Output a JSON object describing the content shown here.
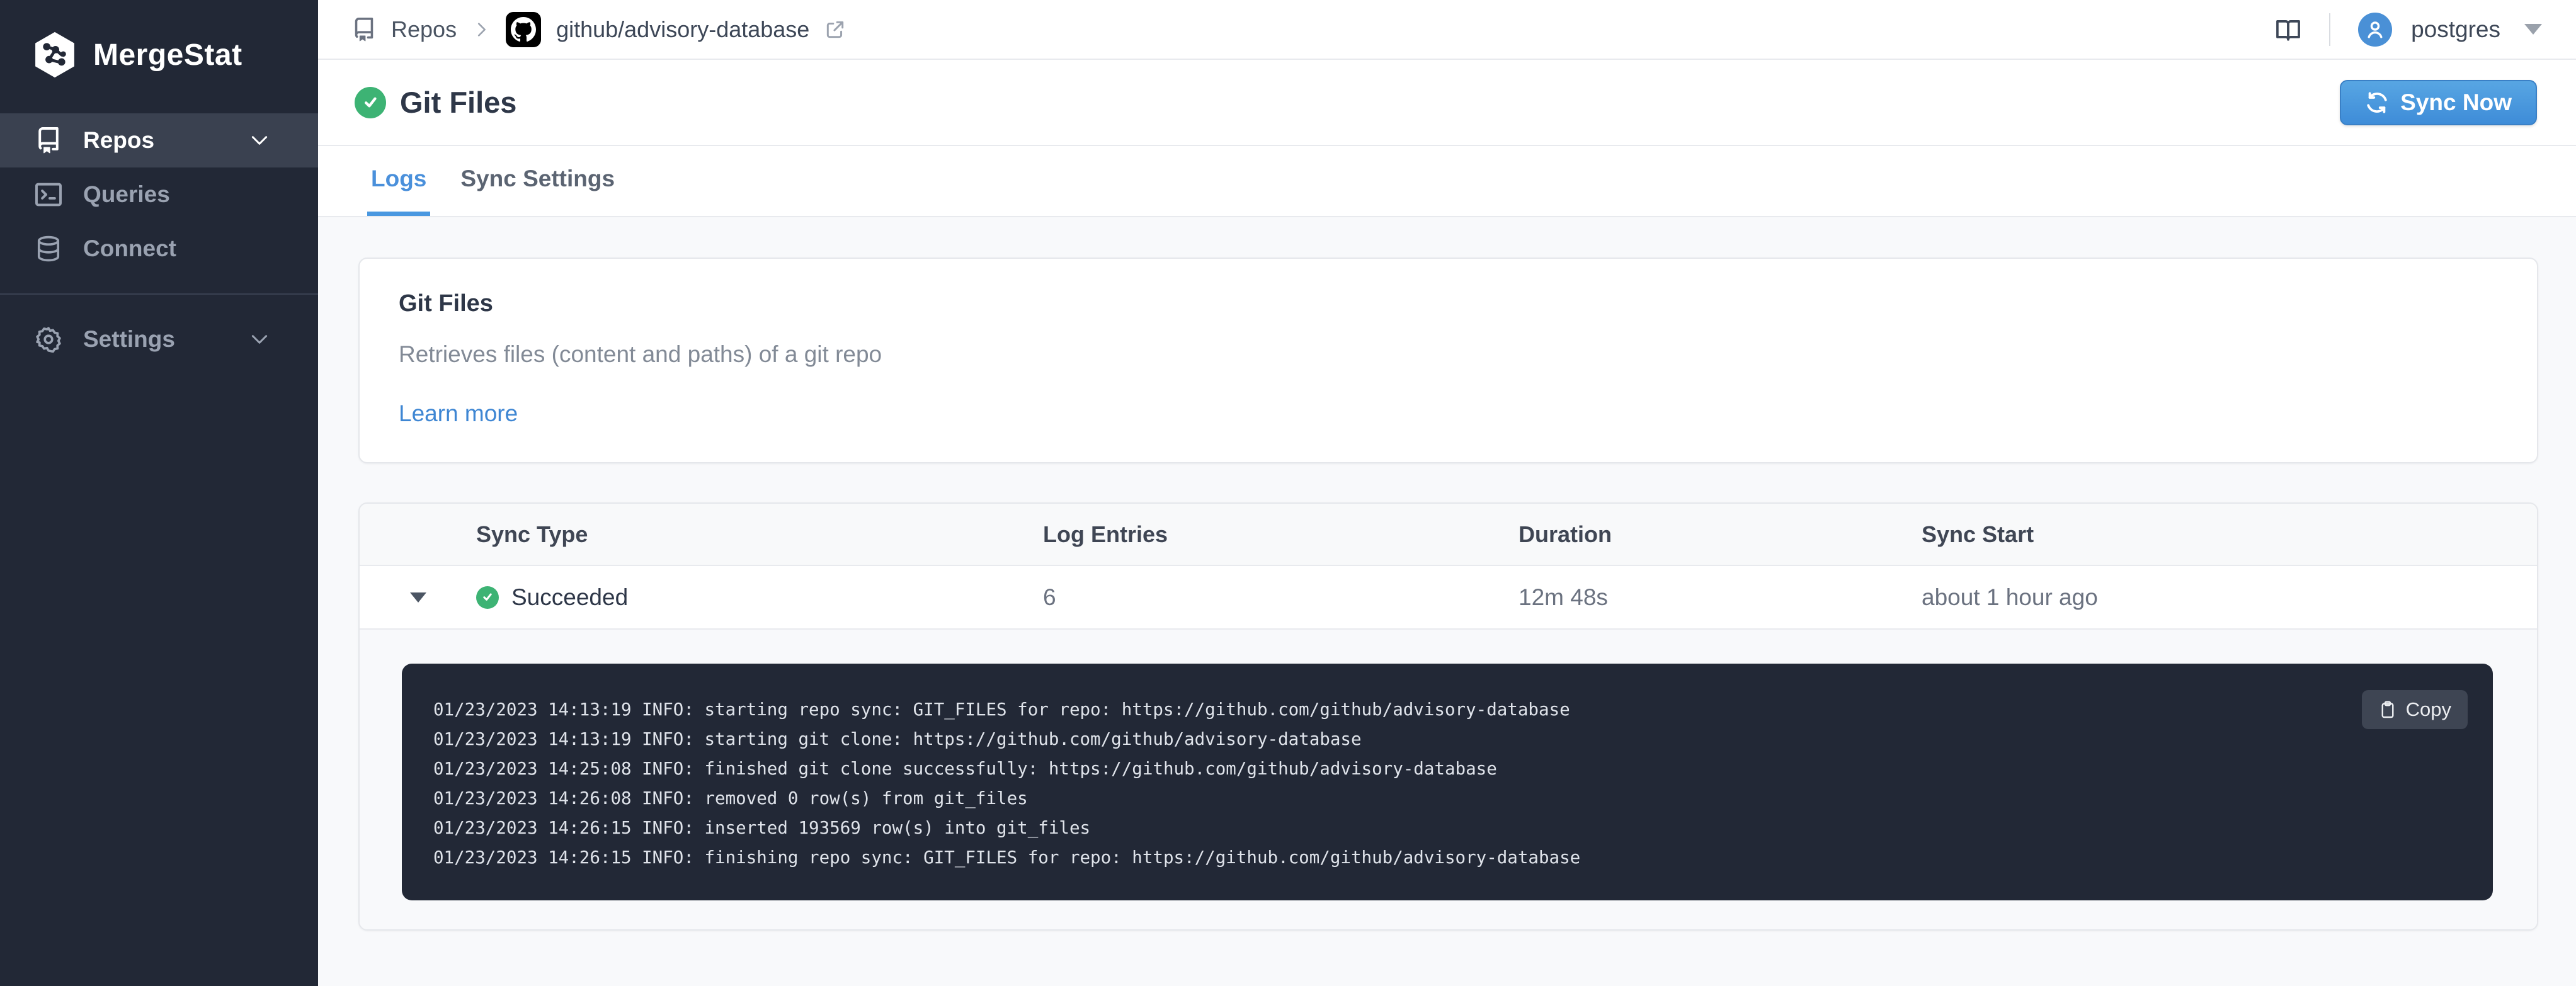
{
  "app_name": "MergeStat",
  "sidebar": {
    "items": [
      {
        "label": "Repos",
        "icon": "repo-icon",
        "active": true,
        "has_chevron": true
      },
      {
        "label": "Queries",
        "icon": "terminal-icon",
        "active": false,
        "has_chevron": false
      },
      {
        "label": "Connect",
        "icon": "database-icon",
        "active": false,
        "has_chevron": false
      },
      {
        "label": "Settings",
        "icon": "gear-icon",
        "active": false,
        "has_chevron": true
      }
    ]
  },
  "topbar": {
    "breadcrumb": {
      "root": "Repos",
      "repo": "github/advisory-database"
    },
    "user": {
      "name": "postgres"
    }
  },
  "header": {
    "title": "Git Files",
    "status": "succeeded",
    "sync_button_label": "Sync Now"
  },
  "tabs": {
    "logs": "Logs",
    "sync_settings": "Sync Settings",
    "active": "Logs"
  },
  "info_card": {
    "title": "Git Files",
    "description": "Retrieves files (content and paths) of a git repo",
    "link_label": "Learn more"
  },
  "log_table": {
    "columns": [
      "Sync Type",
      "Log Entries",
      "Duration",
      "Sync Start"
    ],
    "row": {
      "status": "Succeeded",
      "log_entries": "6",
      "duration": "12m 48s",
      "sync_start": "about 1 hour ago",
      "expanded": true
    },
    "copy_label": "Copy",
    "log_lines": [
      "01/23/2023 14:13:19 INFO: starting repo sync: GIT_FILES for repo: https://github.com/github/advisory-database",
      "01/23/2023 14:13:19 INFO: starting git clone: https://github.com/github/advisory-database",
      "01/23/2023 14:25:08 INFO: finished git clone successfully: https://github.com/github/advisory-database",
      "01/23/2023 14:26:08 INFO: removed 0 row(s) from git_files",
      "01/23/2023 14:26:15 INFO: inserted 193569 row(s) into git_files",
      "01/23/2023 14:26:15 INFO: finishing repo sync: GIT_FILES for repo: https://github.com/github/advisory-database"
    ]
  },
  "colors": {
    "sidebar_bg": "#222836",
    "sidebar_active_bg": "#3a4150",
    "accent_blue": "#4a90db",
    "success_green": "#3db374",
    "log_panel_bg": "#222836",
    "page_bg": "#f8f9fb"
  }
}
